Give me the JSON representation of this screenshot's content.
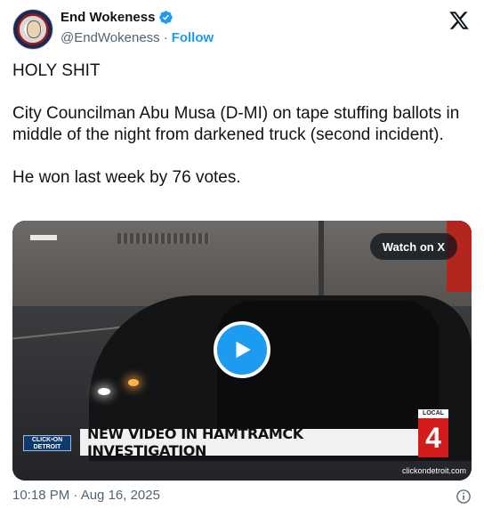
{
  "author": {
    "display_name": "End Wokeness",
    "handle": "@EndWokeness",
    "separator": "·",
    "follow_label": "Follow",
    "verified_color": "#1d9bf0"
  },
  "platform_icon": "x-logo-icon",
  "tweet": {
    "text": "HOLY SHIT\n\nCity Councilman Abu Musa (D-MI) on tape stuffing ballots in middle of the night from darkened truck (second incident).\n\nHe won last week by 76 votes."
  },
  "media": {
    "watch_label": "Watch on X",
    "play_icon": "play-icon",
    "lower_third": {
      "logo_line1": "CLICK•ON",
      "logo_line2": "DETROIT",
      "headline": "NEW VIDEO IN HAMTRAMCK INVESTIGATION",
      "station_local": "LOCAL",
      "station_number": "4",
      "url": "clickondetroit.com"
    }
  },
  "timestamp": "10:18 PM · Aug 16, 2025",
  "info_icon": "info-icon",
  "colors": {
    "accent": "#1d9bf0",
    "text_primary": "#0f1419",
    "text_secondary": "#536471"
  }
}
